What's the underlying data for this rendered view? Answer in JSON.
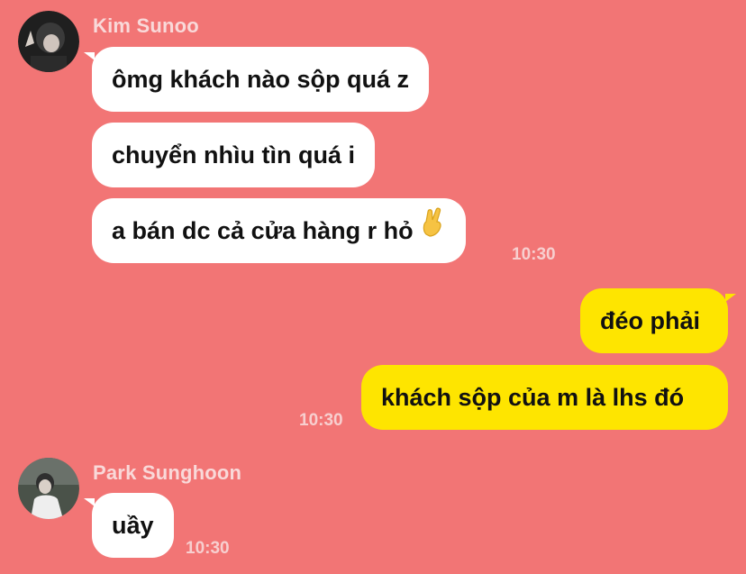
{
  "chat": {
    "groups": [
      {
        "sender": "Kim Sunoo",
        "avatar_icon": "avatar-photo",
        "messages": [
          "ômg khách nào sộp quá z",
          "chuyển nhìu tìn quá i",
          "a bán dc cả cửa hàng r hỏ"
        ],
        "emoji": "crossed-fingers-icon",
        "time": "10:30"
      },
      {
        "sender": "me",
        "messages": [
          "đéo phải",
          "khách sộp của m là lhs đó"
        ],
        "time": "10:30"
      },
      {
        "sender": "Park Sunghoon",
        "avatar_icon": "avatar-photo",
        "messages": [
          "uầy"
        ],
        "time": "10:30"
      }
    ]
  },
  "colors": {
    "background": "#F27575",
    "incoming_bubble": "#FFFFFF",
    "outgoing_bubble": "#FEE500",
    "meta_text": "#F9D9D9"
  }
}
